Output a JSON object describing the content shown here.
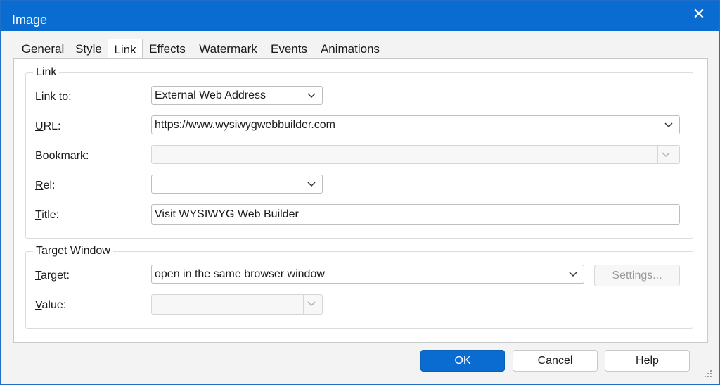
{
  "window": {
    "title": "Image",
    "close_glyph": "✕"
  },
  "tabs": [
    {
      "label": "General"
    },
    {
      "label": "Style"
    },
    {
      "label": "Link",
      "active": true
    },
    {
      "label": "Effects"
    },
    {
      "label": "Watermark"
    },
    {
      "label": "Events"
    },
    {
      "label": "Animations"
    }
  ],
  "link_group": {
    "title": "Link",
    "link_to": {
      "label_ul": "L",
      "label_rest": "ink to:",
      "value": "External Web Address"
    },
    "url": {
      "label_ul": "U",
      "label_rest": "RL:",
      "value": "https://www.wysiwygwebbuilder.com"
    },
    "bookmark": {
      "label_ul": "B",
      "label_rest": "ookmark:",
      "value": ""
    },
    "rel": {
      "label_ul": "R",
      "label_rest": "el:",
      "value": ""
    },
    "title_field": {
      "label_ul": "T",
      "label_rest": "itle:",
      "value": "Visit WYSIWYG Web Builder"
    }
  },
  "target_group": {
    "title": "Target Window",
    "target": {
      "label_ul": "T",
      "label_rest": "arget:",
      "value": "open in the same browser window"
    },
    "settings_label": "Settings...",
    "value": {
      "label_ul": "V",
      "label_rest": "alue:",
      "value": ""
    }
  },
  "buttons": {
    "ok": "OK",
    "cancel": "Cancel",
    "help": "Help"
  },
  "colors": {
    "accent": "#0a6cd1",
    "dialog_bg": "#f3f3f3",
    "panel_bg": "#ffffff"
  }
}
